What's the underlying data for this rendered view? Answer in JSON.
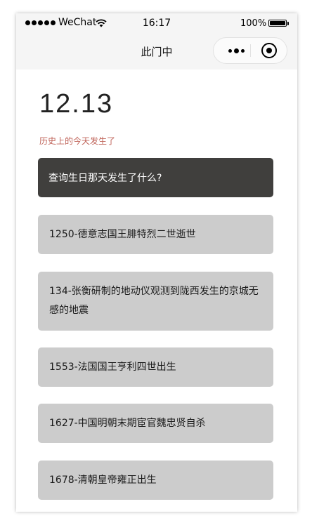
{
  "status_bar": {
    "carrier": "WeChat",
    "time": "16:17",
    "battery_percent": "100%"
  },
  "nav": {
    "title": "此门中",
    "more_icon": "more-dots-icon",
    "close_icon": "circle-close-icon"
  },
  "page": {
    "date": "12.13",
    "subtitle": "历史上的今天发生了",
    "query_button": "查询生日那天发生了什么?"
  },
  "events": [
    "1250-德意志国王腓特烈二世逝世",
    "134-张衡研制的地动仪观测到陇西发生的京城无感的地震",
    "1553-法国国王亨利四世出生",
    "1627-中国明朝末期宦官魏忠贤自杀",
    "1678-清朝皇帝雍正出生"
  ],
  "colors": {
    "header_bg": "#f5f5f5",
    "query_button_bg": "#403f3d",
    "event_bg": "#cccccc",
    "subtitle": "#c0645a"
  }
}
